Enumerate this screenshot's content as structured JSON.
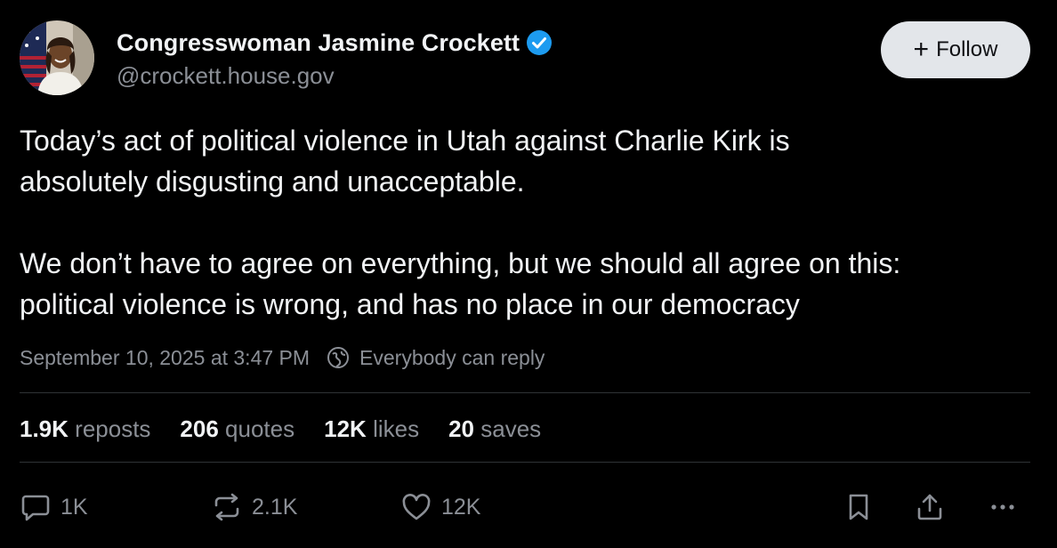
{
  "author": {
    "display_name": "Congresswoman Jasmine Crockett",
    "handle": "@crockett.house.gov",
    "verified_color": "#1d9bf0",
    "avatar_icon": "profile-photo"
  },
  "follow_button": {
    "label": "Follow",
    "icon": "plus-icon"
  },
  "post": {
    "paragraph_1_line_1": "Today’s act of political violence in Utah against Charlie Kirk is",
    "paragraph_1_line_2": "absolutely disgusting and unacceptable.",
    "paragraph_2_line_1": "We don’t have to agree on everything, but we should all agree on this:",
    "paragraph_2_line_2": "political violence is wrong, and has no place in our democracy",
    "timestamp": "September 10, 2025 at 3:47 PM",
    "reply_setting": "Everybody can reply"
  },
  "stats": {
    "reposts": {
      "count": "1.9K",
      "label": "reposts"
    },
    "quotes": {
      "count": "206",
      "label": "quotes"
    },
    "likes": {
      "count": "12K",
      "label": "likes"
    },
    "saves": {
      "count": "20",
      "label": "saves"
    }
  },
  "actions": {
    "reply": {
      "count": "1K",
      "icon": "comment-icon"
    },
    "repost": {
      "count": "2.1K",
      "icon": "repost-icon"
    },
    "like": {
      "count": "12K",
      "icon": "heart-icon"
    },
    "save": {
      "icon": "bookmark-icon"
    },
    "share": {
      "icon": "share-icon"
    },
    "more": {
      "icon": "more-icon"
    }
  },
  "colors": {
    "background": "#000000",
    "text_primary": "#f1f3f5",
    "text_secondary": "#8b8f96",
    "divider": "#2f3336",
    "follow_bg": "#e3e6ea"
  }
}
